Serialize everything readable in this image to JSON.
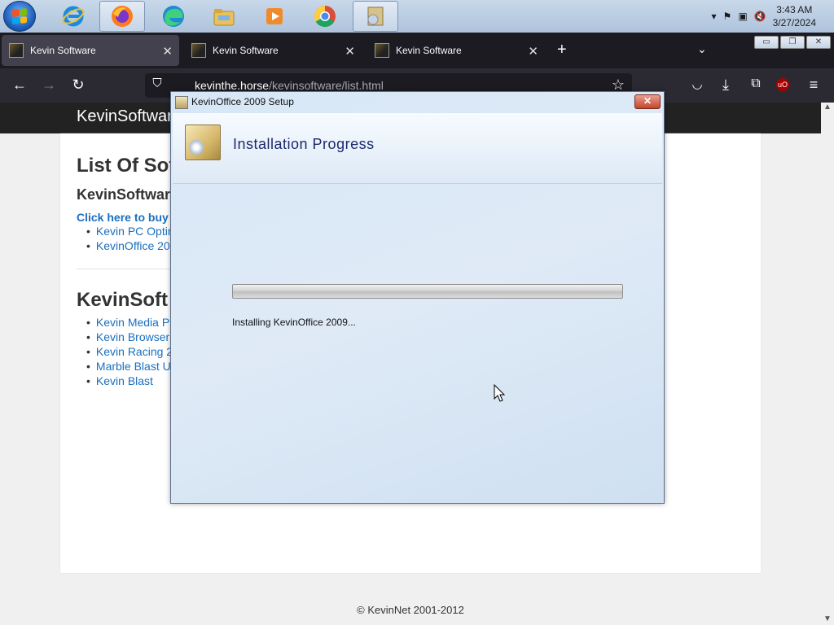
{
  "taskbar": {
    "pinned": [
      {
        "name": "internet-explorer-icon",
        "color": "#1a8ce0"
      },
      {
        "name": "firefox-icon",
        "color": "#ff7b1c"
      },
      {
        "name": "edge-icon",
        "color": "#31b67a"
      },
      {
        "name": "file-explorer-icon",
        "color": "#e8c15a"
      },
      {
        "name": "media-player-icon",
        "color": "#ef8b2a"
      },
      {
        "name": "chrome-icon",
        "color": "#dd4b39"
      },
      {
        "name": "setup-icon",
        "color": "#d8c28a"
      }
    ],
    "clock_time": "3:43 AM",
    "clock_date": "3/27/2024"
  },
  "browser": {
    "tabs": [
      {
        "title": "Kevin Software"
      },
      {
        "title": "Kevin Software"
      },
      {
        "title": "Kevin Software"
      }
    ],
    "url_host": "kevinthe.horse",
    "url_path": "/kevinsoftware/list.html"
  },
  "page": {
    "site_title": "KevinSoftwar",
    "heading": "List Of Sof",
    "section1": "KevinSoftwar",
    "buy_link": "Click here to buy a",
    "list1": [
      "Kevin PC Optim",
      "KevinOffice 200"
    ],
    "section2": "KevinSoft",
    "list2": [
      "Kevin Media Pla",
      "Kevin Browser",
      "Kevin Racing 20",
      "Marble Blast Ul",
      "Kevin Blast"
    ],
    "footer": "© KevinNet 2001-2012"
  },
  "dialog": {
    "title": "KevinOffice 2009 Setup",
    "heading": "Installation Progress",
    "status": "Installing KevinOffice 2009...",
    "progress": 0
  }
}
